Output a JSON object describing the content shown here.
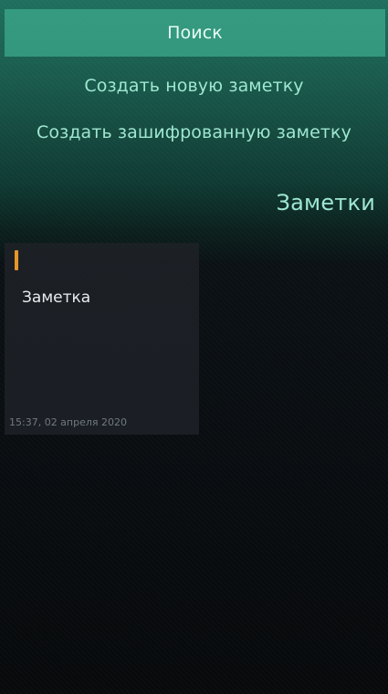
{
  "pulley_menu": {
    "search_label": "Поиск",
    "create_note_label": "Создать новую заметку",
    "create_encrypted_label": "Создать зашифрованную заметку"
  },
  "page": {
    "title": "Заметки"
  },
  "notes": [
    {
      "title": "Заметка",
      "timestamp": "15:37, 02 апреля 2020",
      "color": "#e6962a"
    }
  ],
  "colors": {
    "accent": "#9ee7d0",
    "highlight": "#3caa8c",
    "note_color": "#e6962a"
  }
}
